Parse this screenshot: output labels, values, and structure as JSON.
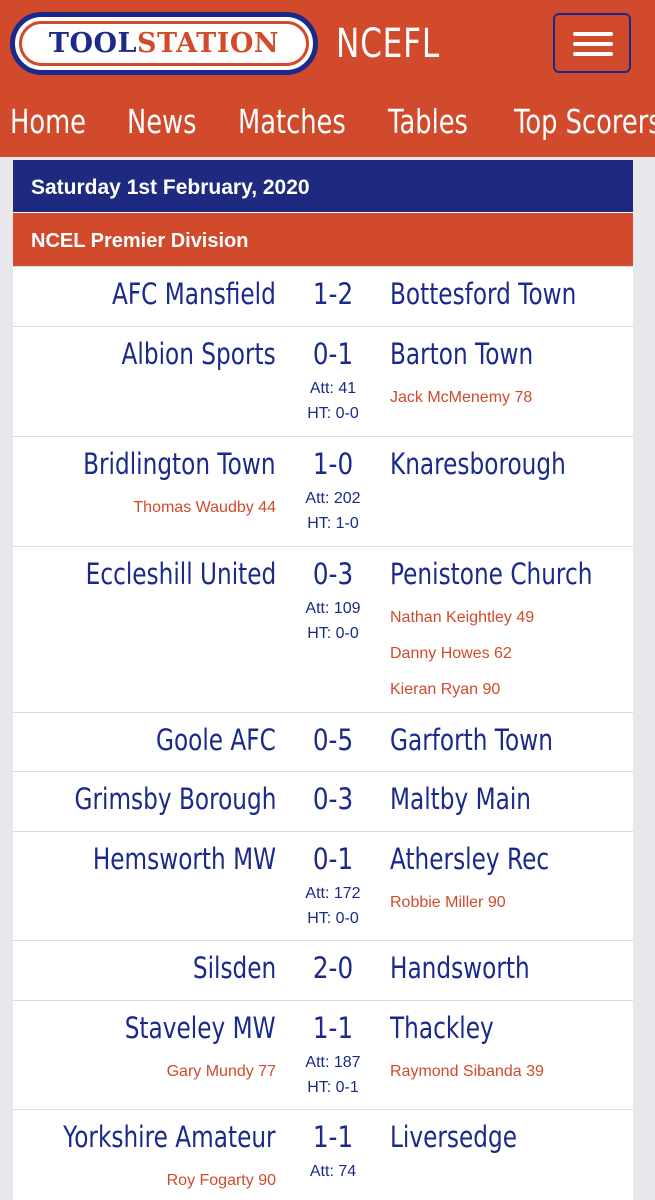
{
  "header": {
    "logo_part1": "TOOL",
    "logo_part2": "STATION",
    "site_name": "NCEFL"
  },
  "nav": [
    "Home",
    "News",
    "Matches",
    "Tables",
    "Top Scorers"
  ],
  "date": "Saturday 1st February, 2020",
  "division": "NCEL Premier Division",
  "matches": [
    {
      "home": "AFC Mansfield",
      "score": "1-2",
      "away": "Bottesford Town"
    },
    {
      "home": "Albion Sports",
      "score": "0-1",
      "away": "Barton Town",
      "att": "Att: 41",
      "ht": "HT: 0-0",
      "away_scorers": [
        "Jack McMenemy 78"
      ]
    },
    {
      "home": "Bridlington Town",
      "score": "1-0",
      "away": "Knaresborough",
      "att": "Att: 202",
      "ht": "HT: 1-0",
      "home_scorers": [
        "Thomas Waudby 44"
      ]
    },
    {
      "home": "Eccleshill United",
      "score": "0-3",
      "away": "Penistone Church",
      "att": "Att: 109",
      "ht": "HT: 0-0",
      "away_scorers": [
        "Nathan Keightley 49",
        "Danny Howes 62",
        "Kieran Ryan 90"
      ]
    },
    {
      "home": "Goole AFC",
      "score": "0-5",
      "away": "Garforth Town"
    },
    {
      "home": "Grimsby Borough",
      "score": "0-3",
      "away": "Maltby Main"
    },
    {
      "home": "Hemsworth MW",
      "score": "0-1",
      "away": "Athersley Rec",
      "att": "Att: 172",
      "ht": "HT: 0-0",
      "away_scorers": [
        "Robbie Miller 90"
      ]
    },
    {
      "home": "Silsden",
      "score": "2-0",
      "away": "Handsworth"
    },
    {
      "home": "Staveley MW",
      "score": "1-1",
      "away": "Thackley",
      "att": "Att: 187",
      "ht": "HT: 0-1",
      "home_scorers": [
        "Gary Mundy 77"
      ],
      "away_scorers": [
        "Raymond Sibanda 39"
      ]
    },
    {
      "home": "Yorkshire Amateur",
      "score": "1-1",
      "away": "Liversedge",
      "att": "Att: 74",
      "home_scorers": [
        "Roy Fogarty 90"
      ]
    }
  ]
}
